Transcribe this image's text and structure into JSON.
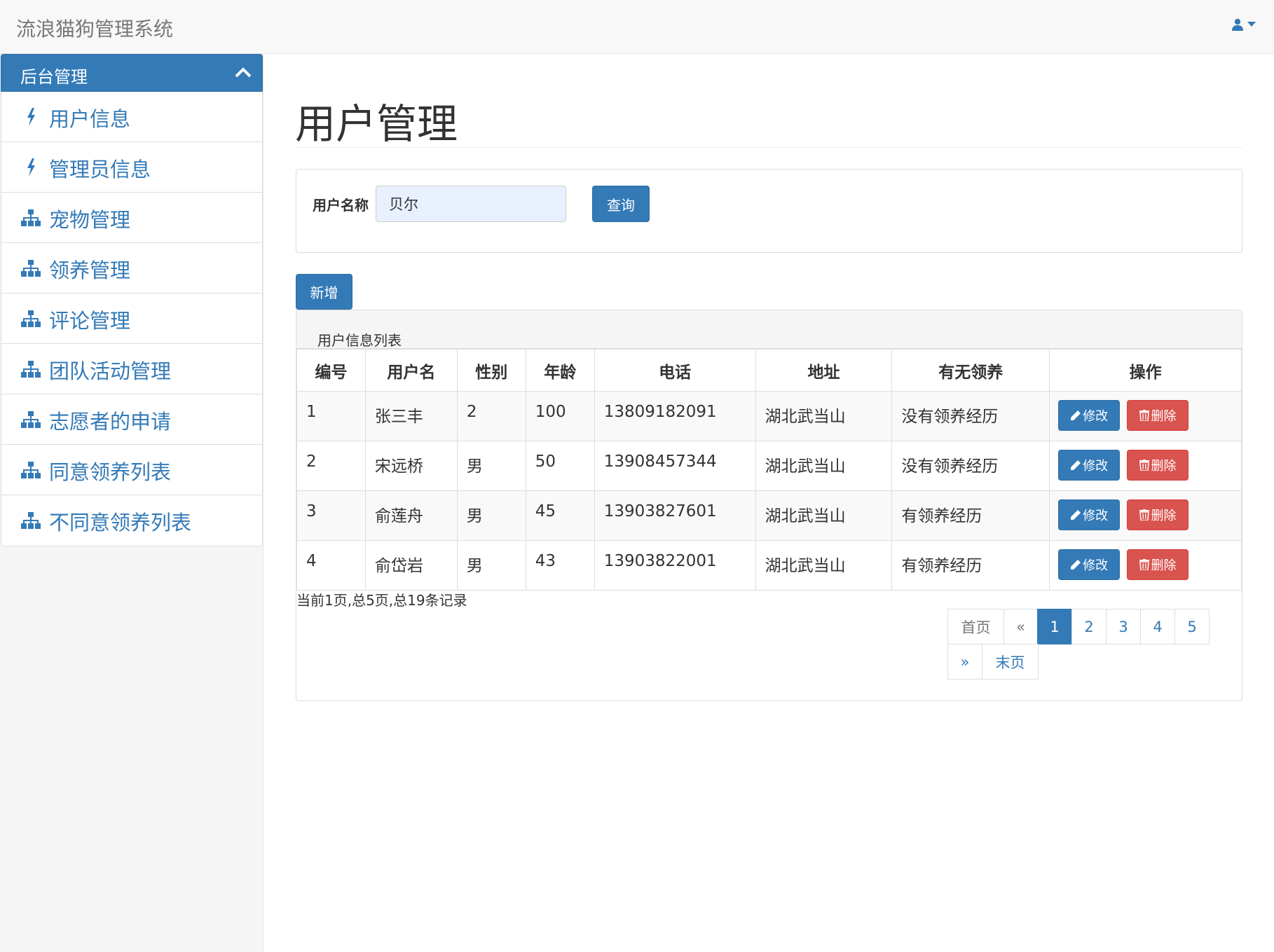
{
  "app": {
    "title": "流浪猫狗管理系统"
  },
  "sidebar": {
    "header": "后台管理",
    "items": [
      {
        "label": "用户信息",
        "icon": "bolt-icon"
      },
      {
        "label": "管理员信息",
        "icon": "bolt-icon"
      },
      {
        "label": "宠物管理",
        "icon": "sitemap-icon"
      },
      {
        "label": "领养管理",
        "icon": "sitemap-icon"
      },
      {
        "label": "评论管理",
        "icon": "sitemap-icon"
      },
      {
        "label": "团队活动管理",
        "icon": "sitemap-icon"
      },
      {
        "label": "志愿者的申请",
        "icon": "sitemap-icon"
      },
      {
        "label": "同意领养列表",
        "icon": "sitemap-icon"
      },
      {
        "label": "不同意领养列表",
        "icon": "sitemap-icon"
      }
    ]
  },
  "main": {
    "title": "用户管理",
    "search": {
      "label": "用户名称",
      "value": "贝尔",
      "button": "查询"
    },
    "add_button": "新增",
    "list_title": "用户信息列表",
    "columns": [
      "编号",
      "用户名",
      "性别",
      "年龄",
      "电话",
      "地址",
      "有无领养",
      "操作"
    ],
    "rows": [
      [
        "1",
        "张三丰",
        "2",
        "100",
        "13809182091",
        "湖北武当山",
        "没有领养经历"
      ],
      [
        "2",
        "宋远桥",
        "男",
        "50",
        "13908457344",
        "湖北武当山",
        "没有领养经历"
      ],
      [
        "3",
        "俞莲舟",
        "男",
        "45",
        "13903827601",
        "湖北武当山",
        "有领养经历"
      ],
      [
        "4",
        "俞岱岩",
        "男",
        "43",
        "13903822001",
        "湖北武当山",
        "有领养经历"
      ]
    ],
    "edit_label": "修改",
    "delete_label": "删除",
    "page_info": "当前1页,总5页,总19条记录",
    "pagination": {
      "first": "首页",
      "prev": "«",
      "pages": [
        "1",
        "2",
        "3",
        "4",
        "5"
      ],
      "next": "»",
      "last": "末页",
      "current": "1"
    }
  },
  "colors": {
    "primary": "#337ab7",
    "danger": "#d9534f",
    "navbar": "#f8f8f8"
  }
}
